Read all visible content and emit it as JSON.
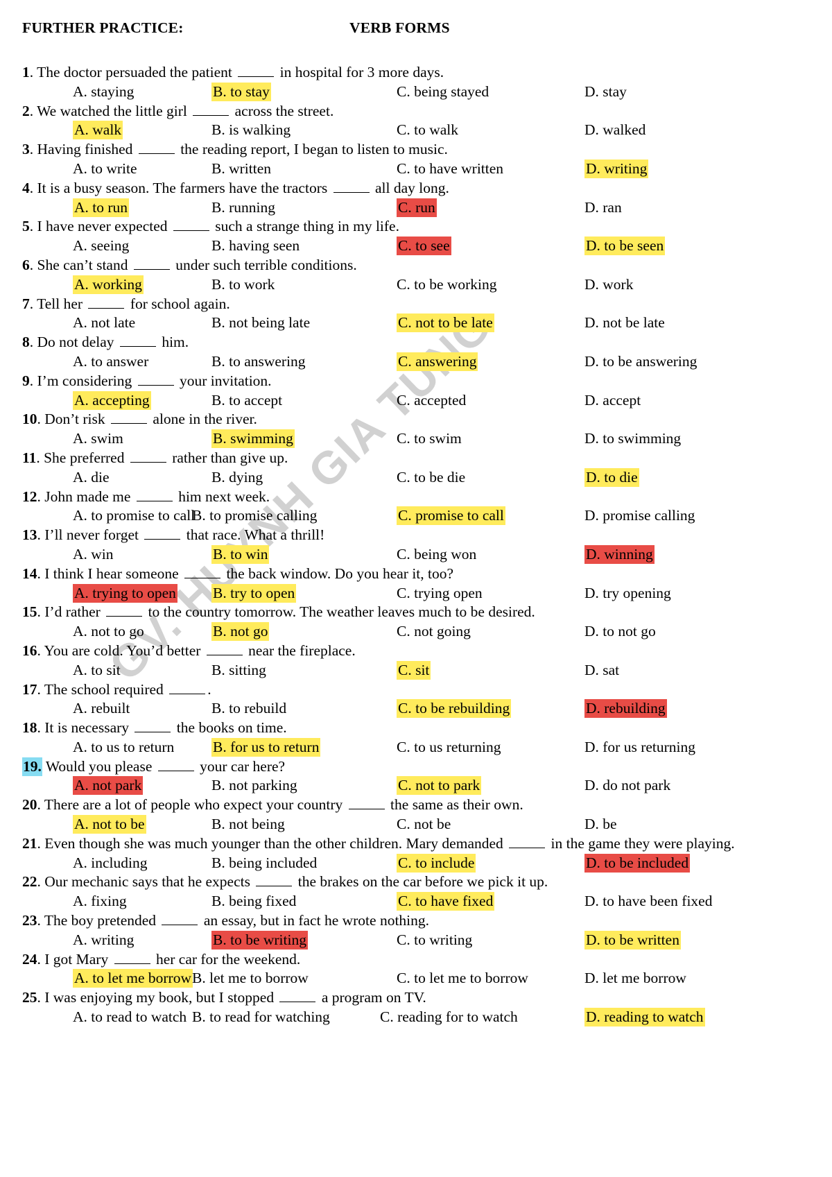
{
  "watermark": {
    "text": "GV. HUYNH GIA TÙNG"
  },
  "header": {
    "left": "FURTHER PRACTICE:",
    "right": "VERB FORMS"
  },
  "colors": {
    "yellow_highlight": "#ffeb5c",
    "red_highlight": "#e84c46",
    "cyan_highlight": "#86dcf2",
    "text": "#000000",
    "watermark": "#c9c9c9"
  },
  "questions": [
    {
      "num": "1",
      "stem_before": ". The doctor persuaded the patient ",
      "stem_after": " in hospital for 3 more days.",
      "num_highlight": "none",
      "options": [
        {
          "label": "A. staying",
          "highlight": "none"
        },
        {
          "label": "B. to stay",
          "highlight": "yellow"
        },
        {
          "label": "C. being stayed",
          "highlight": "none"
        },
        {
          "label": "D. stay",
          "highlight": "none"
        }
      ]
    },
    {
      "num": "2",
      "stem_before": ". We watched the little girl ",
      "stem_after": " across the street.",
      "num_highlight": "none",
      "options": [
        {
          "label": "A. walk",
          "highlight": "yellow"
        },
        {
          "label": "B. is walking",
          "highlight": "none"
        },
        {
          "label": "C. to walk",
          "highlight": "none"
        },
        {
          "label": "D. walked",
          "highlight": "none"
        }
      ]
    },
    {
      "num": "3",
      "stem_before": ". Having finished ",
      "stem_after": " the reading report, I began to listen to music.",
      "num_highlight": "none",
      "options": [
        {
          "label": "A. to write",
          "highlight": "none"
        },
        {
          "label": "B. written",
          "highlight": "none"
        },
        {
          "label": "C. to have written",
          "highlight": "none"
        },
        {
          "label": "D. writing",
          "highlight": "yellow"
        }
      ]
    },
    {
      "num": "4",
      "stem_before": ". It is a busy season. The farmers have the tractors ",
      "stem_after": " all day long.",
      "num_highlight": "none",
      "options": [
        {
          "label": "A. to run",
          "highlight": "yellow"
        },
        {
          "label": "B. running",
          "highlight": "none"
        },
        {
          "label": "C. run",
          "highlight": "red"
        },
        {
          "label": "D. ran",
          "highlight": "none"
        }
      ]
    },
    {
      "num": "5",
      "stem_before": ". I have never expected ",
      "stem_after": " such a strange thing in my life.",
      "num_highlight": "none",
      "options": [
        {
          "label": "A. seeing",
          "highlight": "none"
        },
        {
          "label": "B. having seen",
          "highlight": "none"
        },
        {
          "label": "C. to see",
          "highlight": "red"
        },
        {
          "label": "D. to be seen",
          "highlight": "yellow"
        }
      ]
    },
    {
      "num": "6",
      "stem_before": ". She can’t stand ",
      "stem_after": " under such terrible conditions.",
      "num_highlight": "none",
      "options": [
        {
          "label": "A. working",
          "highlight": "yellow"
        },
        {
          "label": "B. to work",
          "highlight": "none"
        },
        {
          "label": "C. to be working",
          "highlight": "none"
        },
        {
          "label": "D. work",
          "highlight": "none"
        }
      ]
    },
    {
      "num": "7",
      "stem_before": ". Tell her ",
      "stem_after": " for school again.",
      "num_highlight": "none",
      "options": [
        {
          "label": "A. not late",
          "highlight": "none"
        },
        {
          "label": "B. not being late",
          "highlight": "none"
        },
        {
          "label": "C. not to be late",
          "highlight": "yellow"
        },
        {
          "label": "D. not be late",
          "highlight": "none"
        }
      ]
    },
    {
      "num": "8",
      "stem_before": ". Do not delay ",
      "stem_after": " him.",
      "num_highlight": "none",
      "options": [
        {
          "label": "A. to answer",
          "highlight": "none"
        },
        {
          "label": "B. to answering",
          "highlight": "none"
        },
        {
          "label": "C. answering",
          "highlight": "yellow"
        },
        {
          "label": "D. to be answering",
          "highlight": "none"
        }
      ]
    },
    {
      "num": "9",
      "stem_before": ". I’m considering ",
      "stem_after": " your invitation.",
      "num_highlight": "none",
      "options": [
        {
          "label": "A. accepting",
          "highlight": "yellow"
        },
        {
          "label": "B. to accept",
          "highlight": "none"
        },
        {
          "label": "C. accepted",
          "highlight": "none"
        },
        {
          "label": "D. accept",
          "highlight": "none"
        }
      ]
    },
    {
      "num": "10",
      "stem_before": ". Don’t risk ",
      "stem_after": " alone in the river.",
      "num_highlight": "none",
      "options": [
        {
          "label": "A. swim",
          "highlight": "none"
        },
        {
          "label": "B. swimming",
          "highlight": "yellow"
        },
        {
          "label": "C. to swim",
          "highlight": "none"
        },
        {
          "label": "D. to swimming",
          "highlight": "none"
        }
      ]
    },
    {
      "num": "11",
      "stem_before": ". She preferred ",
      "stem_after": " rather than give up.",
      "num_highlight": "none",
      "options": [
        {
          "label": "A. die",
          "highlight": "none"
        },
        {
          "label": "B. dying",
          "highlight": "none"
        },
        {
          "label": "C. to be die",
          "highlight": "none"
        },
        {
          "label": "D. to die",
          "highlight": "yellow"
        }
      ]
    },
    {
      "num": "12",
      "stem_before": ". John made me ",
      "stem_after": " him next week.",
      "num_highlight": "none",
      "options": [
        {
          "label": "A. to promise to call",
          "highlight": "none"
        },
        {
          "label": "B. to promise calling",
          "highlight": "none"
        },
        {
          "label": "C. promise to call",
          "highlight": "yellow"
        },
        {
          "label": "D. promise calling",
          "highlight": "none"
        }
      ]
    },
    {
      "num": "13",
      "stem_before": ". I’ll never forget ",
      "stem_after": " that race. What a thrill!",
      "num_highlight": "none",
      "options": [
        {
          "label": "A. win",
          "highlight": "none"
        },
        {
          "label": "B. to win",
          "highlight": "yellow"
        },
        {
          "label": "C. being won",
          "highlight": "none"
        },
        {
          "label": "D. winning",
          "highlight": "red"
        }
      ]
    },
    {
      "num": "14",
      "stem_before": ". I think I hear someone ",
      "stem_after": " the back window. Do you hear it, too?",
      "num_highlight": "none",
      "options": [
        {
          "label": "A. trying to open",
          "highlight": "red"
        },
        {
          "label": "B. try to open",
          "highlight": "yellow"
        },
        {
          "label": "C. trying open",
          "highlight": "none"
        },
        {
          "label": "D. try opening",
          "highlight": "none"
        }
      ]
    },
    {
      "num": "15",
      "stem_before": ". I’d rather ",
      "stem_after": " to the country tomorrow. The weather leaves much to be desired.",
      "num_highlight": "none",
      "options": [
        {
          "label": "A. not to go",
          "highlight": "none"
        },
        {
          "label": "B. not go",
          "highlight": "yellow"
        },
        {
          "label": "C. not going",
          "highlight": "none"
        },
        {
          "label": "D. to not go",
          "highlight": "none"
        }
      ]
    },
    {
      "num": "16",
      "stem_before": ". You are cold. You’d better ",
      "stem_after": " near the fireplace.",
      "num_highlight": "none",
      "options": [
        {
          "label": "A. to sit",
          "highlight": "none"
        },
        {
          "label": "B. sitting",
          "highlight": "none"
        },
        {
          "label": "C. sit",
          "highlight": "yellow"
        },
        {
          "label": "D. sat",
          "highlight": "none"
        }
      ]
    },
    {
      "num": "17",
      "stem_before": ". The school required ",
      "stem_after": ".",
      "num_highlight": "none",
      "options": [
        {
          "label": "A. rebuilt",
          "highlight": "none"
        },
        {
          "label": "B. to rebuild",
          "highlight": "none"
        },
        {
          "label": "C. to be rebuilding",
          "highlight": "yellow"
        },
        {
          "label": "D. rebuilding",
          "highlight": "red"
        }
      ]
    },
    {
      "num": "18",
      "stem_before": ". It is necessary ",
      "stem_after": " the books on time.",
      "num_highlight": "none",
      "options": [
        {
          "label": "A. to us to return",
          "highlight": "none"
        },
        {
          "label": "B. for us to return",
          "highlight": "yellow"
        },
        {
          "label": "C. to us returning",
          "highlight": "none"
        },
        {
          "label": "D. for us returning",
          "highlight": "none"
        }
      ]
    },
    {
      "num": "19",
      "stem_before": ". Would you please ",
      "stem_after": " your car here?",
      "num_highlight": "cyan",
      "options": [
        {
          "label": "A. not park",
          "highlight": "red"
        },
        {
          "label": "B. not parking",
          "highlight": "none"
        },
        {
          "label": "C. not to park",
          "highlight": "yellow"
        },
        {
          "label": "D. do not park",
          "highlight": "none"
        }
      ]
    },
    {
      "num": "20",
      "stem_before": ". There are a lot of people who expect your country ",
      "stem_after": " the same as their own.",
      "num_highlight": "none",
      "options": [
        {
          "label": "A. not to be",
          "highlight": "yellow"
        },
        {
          "label": "B. not being",
          "highlight": "none"
        },
        {
          "label": "C. not be",
          "highlight": "none"
        },
        {
          "label": "D. be",
          "highlight": "none"
        }
      ]
    },
    {
      "num": "21",
      "stem_before": ". Even though she was much younger than the other children. Mary demanded ",
      "stem_after": " in the game they were playing.",
      "num_highlight": "none",
      "wrap": true,
      "options": [
        {
          "label": "A. including",
          "highlight": "none"
        },
        {
          "label": "B. being included",
          "highlight": "none"
        },
        {
          "label": "C. to include",
          "highlight": "yellow"
        },
        {
          "label": "D. to be included",
          "highlight": "red"
        }
      ]
    },
    {
      "num": "22",
      "stem_before": ". Our mechanic says that he expects ",
      "stem_after": " the brakes on the car before we pick it up.",
      "num_highlight": "none",
      "options": [
        {
          "label": "A. fixing",
          "highlight": "none"
        },
        {
          "label": "B. being fixed",
          "highlight": "none"
        },
        {
          "label": "C. to have fixed",
          "highlight": "yellow"
        },
        {
          "label": "D. to have been fixed",
          "highlight": "none"
        }
      ]
    },
    {
      "num": "23",
      "stem_before": ". The boy pretended ",
      "stem_after": " an essay, but in fact he wrote nothing.",
      "num_highlight": "none",
      "options": [
        {
          "label": "A. writing",
          "highlight": "none"
        },
        {
          "label": "B. to be writing",
          "highlight": "red"
        },
        {
          "label": "C. to writing",
          "highlight": "none"
        },
        {
          "label": "D. to be written",
          "highlight": "yellow"
        }
      ]
    },
    {
      "num": "24",
      "stem_before": ". I got Mary ",
      "stem_after": " her car for the weekend.",
      "num_highlight": "none",
      "options": [
        {
          "label": "A. to let me borrow",
          "highlight": "yellow"
        },
        {
          "label": "B. let me to borrow",
          "highlight": "none"
        },
        {
          "label": "C. to let me to borrow",
          "highlight": "none"
        },
        {
          "label": "D. let me borrow",
          "highlight": "none"
        }
      ]
    },
    {
      "num": "25",
      "stem_before": ". I was enjoying my book, but I stopped ",
      "stem_after": " a program on TV.",
      "num_highlight": "none",
      "options": [
        {
          "label": "A. to read to watch",
          "highlight": "none"
        },
        {
          "label": "B. to read for watching",
          "highlight": "none"
        },
        {
          "label": "C. reading for to watch",
          "highlight": "none"
        },
        {
          "label": "D. reading to watch",
          "highlight": "yellow"
        }
      ]
    }
  ]
}
